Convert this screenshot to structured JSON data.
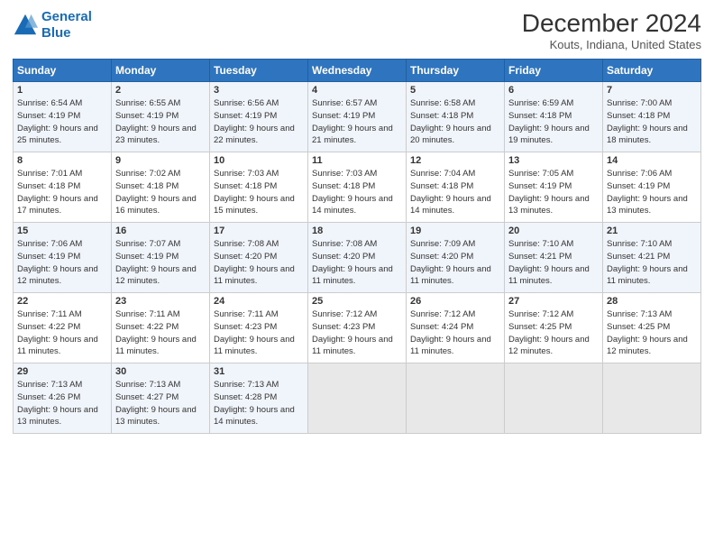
{
  "header": {
    "logo_line1": "General",
    "logo_line2": "Blue",
    "title": "December 2024",
    "location": "Kouts, Indiana, United States"
  },
  "days_of_week": [
    "Sunday",
    "Monday",
    "Tuesday",
    "Wednesday",
    "Thursday",
    "Friday",
    "Saturday"
  ],
  "weeks": [
    [
      {
        "day": 1,
        "sunrise": "6:54 AM",
        "sunset": "4:19 PM",
        "daylight": "9 hours and 25 minutes."
      },
      {
        "day": 2,
        "sunrise": "6:55 AM",
        "sunset": "4:19 PM",
        "daylight": "9 hours and 23 minutes."
      },
      {
        "day": 3,
        "sunrise": "6:56 AM",
        "sunset": "4:19 PM",
        "daylight": "9 hours and 22 minutes."
      },
      {
        "day": 4,
        "sunrise": "6:57 AM",
        "sunset": "4:19 PM",
        "daylight": "9 hours and 21 minutes."
      },
      {
        "day": 5,
        "sunrise": "6:58 AM",
        "sunset": "4:18 PM",
        "daylight": "9 hours and 20 minutes."
      },
      {
        "day": 6,
        "sunrise": "6:59 AM",
        "sunset": "4:18 PM",
        "daylight": "9 hours and 19 minutes."
      },
      {
        "day": 7,
        "sunrise": "7:00 AM",
        "sunset": "4:18 PM",
        "daylight": "9 hours and 18 minutes."
      }
    ],
    [
      {
        "day": 8,
        "sunrise": "7:01 AM",
        "sunset": "4:18 PM",
        "daylight": "9 hours and 17 minutes."
      },
      {
        "day": 9,
        "sunrise": "7:02 AM",
        "sunset": "4:18 PM",
        "daylight": "9 hours and 16 minutes."
      },
      {
        "day": 10,
        "sunrise": "7:03 AM",
        "sunset": "4:18 PM",
        "daylight": "9 hours and 15 minutes."
      },
      {
        "day": 11,
        "sunrise": "7:03 AM",
        "sunset": "4:18 PM",
        "daylight": "9 hours and 14 minutes."
      },
      {
        "day": 12,
        "sunrise": "7:04 AM",
        "sunset": "4:18 PM",
        "daylight": "9 hours and 14 minutes."
      },
      {
        "day": 13,
        "sunrise": "7:05 AM",
        "sunset": "4:19 PM",
        "daylight": "9 hours and 13 minutes."
      },
      {
        "day": 14,
        "sunrise": "7:06 AM",
        "sunset": "4:19 PM",
        "daylight": "9 hours and 13 minutes."
      }
    ],
    [
      {
        "day": 15,
        "sunrise": "7:06 AM",
        "sunset": "4:19 PM",
        "daylight": "9 hours and 12 minutes."
      },
      {
        "day": 16,
        "sunrise": "7:07 AM",
        "sunset": "4:19 PM",
        "daylight": "9 hours and 12 minutes."
      },
      {
        "day": 17,
        "sunrise": "7:08 AM",
        "sunset": "4:20 PM",
        "daylight": "9 hours and 11 minutes."
      },
      {
        "day": 18,
        "sunrise": "7:08 AM",
        "sunset": "4:20 PM",
        "daylight": "9 hours and 11 minutes."
      },
      {
        "day": 19,
        "sunrise": "7:09 AM",
        "sunset": "4:20 PM",
        "daylight": "9 hours and 11 minutes."
      },
      {
        "day": 20,
        "sunrise": "7:10 AM",
        "sunset": "4:21 PM",
        "daylight": "9 hours and 11 minutes."
      },
      {
        "day": 21,
        "sunrise": "7:10 AM",
        "sunset": "4:21 PM",
        "daylight": "9 hours and 11 minutes."
      }
    ],
    [
      {
        "day": 22,
        "sunrise": "7:11 AM",
        "sunset": "4:22 PM",
        "daylight": "9 hours and 11 minutes."
      },
      {
        "day": 23,
        "sunrise": "7:11 AM",
        "sunset": "4:22 PM",
        "daylight": "9 hours and 11 minutes."
      },
      {
        "day": 24,
        "sunrise": "7:11 AM",
        "sunset": "4:23 PM",
        "daylight": "9 hours and 11 minutes."
      },
      {
        "day": 25,
        "sunrise": "7:12 AM",
        "sunset": "4:23 PM",
        "daylight": "9 hours and 11 minutes."
      },
      {
        "day": 26,
        "sunrise": "7:12 AM",
        "sunset": "4:24 PM",
        "daylight": "9 hours and 11 minutes."
      },
      {
        "day": 27,
        "sunrise": "7:12 AM",
        "sunset": "4:25 PM",
        "daylight": "9 hours and 12 minutes."
      },
      {
        "day": 28,
        "sunrise": "7:13 AM",
        "sunset": "4:25 PM",
        "daylight": "9 hours and 12 minutes."
      }
    ],
    [
      {
        "day": 29,
        "sunrise": "7:13 AM",
        "sunset": "4:26 PM",
        "daylight": "9 hours and 13 minutes."
      },
      {
        "day": 30,
        "sunrise": "7:13 AM",
        "sunset": "4:27 PM",
        "daylight": "9 hours and 13 minutes."
      },
      {
        "day": 31,
        "sunrise": "7:13 AM",
        "sunset": "4:28 PM",
        "daylight": "9 hours and 14 minutes."
      },
      null,
      null,
      null,
      null
    ]
  ]
}
